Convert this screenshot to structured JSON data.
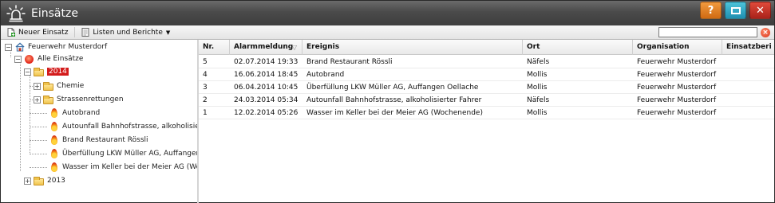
{
  "window": {
    "title": "Einsätze"
  },
  "title_buttons": {
    "help": "?",
    "maximize_icon": "maximize-icon",
    "close": "✕"
  },
  "toolbar": {
    "new_label": "Neuer Einsatz",
    "lists_label": "Listen und Berichte",
    "search_value": "",
    "search_placeholder": ""
  },
  "tree": {
    "root": "Feuerwehr Musterdorf",
    "all": "Alle Einsätze",
    "year_selected": "2014",
    "folders": [
      "Chemie",
      "Strassenrettungen"
    ],
    "incidents": [
      "Autobrand",
      "Autounfall Bahnhofstrasse, alkoholisier",
      "Brand Restaurant Rössli",
      "Überfüllung LKW Müller AG, Auffangen",
      "Wasser im Keller bei der Meier AG (Wo"
    ],
    "year_other": "2013"
  },
  "grid": {
    "columns": [
      "Nr.",
      "Alarmmeldung",
      "Ereignis",
      "Ort",
      "Organisation",
      "Einsatzberi"
    ],
    "sort_icon": "sort-descending-icon",
    "rows": [
      [
        "5",
        "02.07.2014 19:33",
        "Brand Restaurant Rössli",
        "Näfels",
        "Feuerwehr Musterdorf",
        ""
      ],
      [
        "4",
        "16.06.2014 18:45",
        "Autobrand",
        "Mollis",
        "Feuerwehr Musterdorf",
        ""
      ],
      [
        "3",
        "06.04.2014 10:45",
        "Überfüllung LKW Müller AG, Auffangen Oellache",
        "Mollis",
        "Feuerwehr Musterdorf",
        ""
      ],
      [
        "2",
        "24.03.2014 05:34",
        "Autounfall Bahnhofstrasse, alkoholisierter Fahrer",
        "Näfels",
        "Feuerwehr Musterdorf",
        ""
      ],
      [
        "1",
        "12.02.2014 05:26",
        "Wasser im Keller bei der Meier AG (Wochenende)",
        "Mollis",
        "Feuerwehr Musterdorf",
        ""
      ]
    ]
  },
  "colors": {
    "titlebar": "#4a4a4a",
    "selection": "#d31b1b",
    "help": "#e07a20",
    "maximize": "#2aa3c4",
    "close": "#c0301f"
  }
}
